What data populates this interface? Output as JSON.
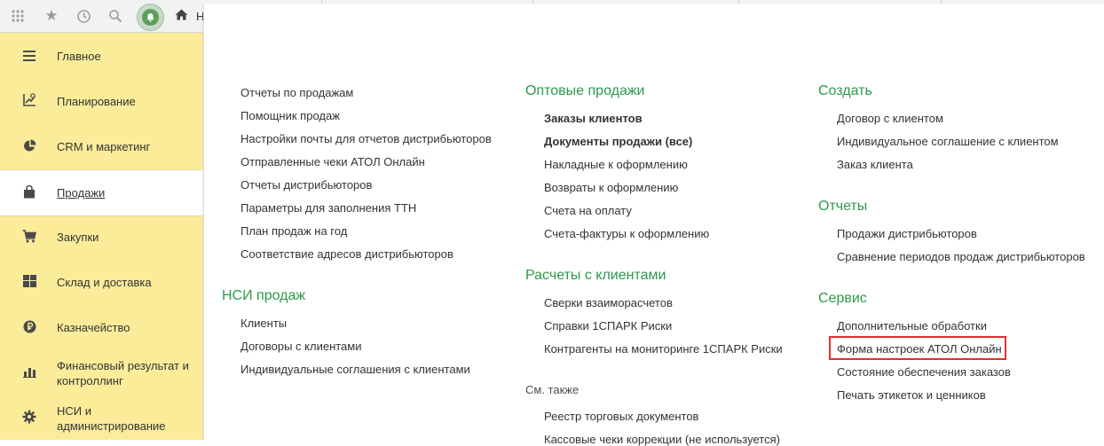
{
  "topbar": {
    "home_label": "Н",
    "icons": [
      "apps-grid-icon",
      "star-icon",
      "history-icon",
      "search-icon",
      "bell-icon",
      "home-icon"
    ]
  },
  "sidebar": {
    "items": [
      {
        "label": "Главное",
        "icon": "menu-icon"
      },
      {
        "label": "Планирование",
        "icon": "planning-chart-icon"
      },
      {
        "label": "CRM и маркетинг",
        "icon": "pie-chart-icon"
      },
      {
        "label": "Продажи",
        "icon": "shopping-bag-icon",
        "active": true
      },
      {
        "label": "Закупки",
        "icon": "cart-icon"
      },
      {
        "label": "Склад и доставка",
        "icon": "warehouse-grid-icon"
      },
      {
        "label": "Казначейство",
        "icon": "ruble-coin-icon"
      },
      {
        "label": "Финансовый результат и контроллинг",
        "icon": "bar-chart-icon"
      },
      {
        "label": "НСИ и администрирование",
        "icon": "gear-icon"
      }
    ]
  },
  "col1": {
    "links": [
      "Отчеты по продажам",
      "Помощник продаж",
      "Настройки почты для отчетов дистрибьюторов",
      "Отправленные чеки АТОЛ Онлайн",
      "Отчеты дистрибьюторов",
      "Параметры для заполнения ТТН",
      "План продаж на год",
      "Соответствие адресов дистрибьюторов"
    ],
    "nsi_heading": "НСИ продаж",
    "nsi_links": [
      "Клиенты",
      "Договоры с клиентами",
      "Индивидуальные соглашения с клиентами"
    ]
  },
  "col2": {
    "wholesale_heading": "Оптовые продажи",
    "wholesale_links": [
      "Заказы клиентов",
      "Документы продажи (все)",
      "Накладные к оформлению",
      "Возвраты к оформлению",
      "Счета на оплату",
      "Счета-фактуры к оформлению"
    ],
    "settlements_heading": "Расчеты с клиентами",
    "settlements_links": [
      "Сверки взаиморасчетов",
      "Справки 1СПАРК Риски",
      "Контрагенты на мониторинге 1СПАРК Риски"
    ],
    "see_also": "См. также",
    "see_also_links": [
      "Реестр торговых документов",
      "Кассовые чеки коррекции (не используется)"
    ]
  },
  "col3": {
    "create_heading": "Создать",
    "create_links": [
      "Договор с клиентом",
      "Индивидуальное соглашение с клиентом",
      "Заказ клиента"
    ],
    "reports_heading": "Отчеты",
    "reports_links": [
      "Продажи дистрибьюторов",
      "Сравнение периодов продаж дистрибьюторов"
    ],
    "service_heading": "Сервис",
    "service_links": [
      "Дополнительные обработки",
      "Форма настроек АТОЛ Онлайн",
      "Состояние обеспечения заказов",
      "Печать этикеток и ценников"
    ]
  },
  "colors": {
    "heading_green": "#2c9a4a",
    "sidebar_yellow": "#fbec9a",
    "highlight_red": "#e03030"
  }
}
